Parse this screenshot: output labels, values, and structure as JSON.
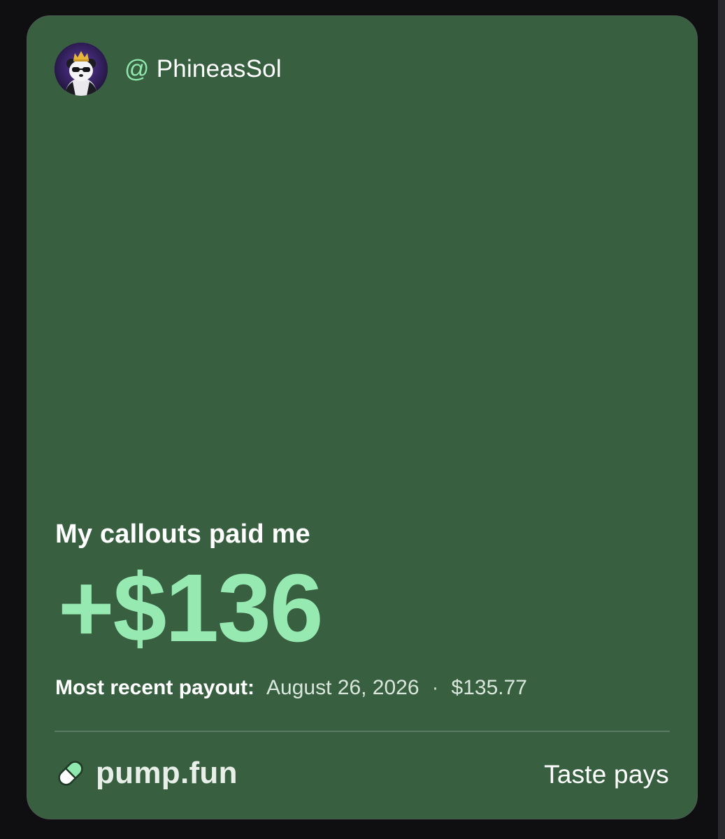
{
  "user": {
    "handle_prefix": "@",
    "handle": "PhineasSol",
    "avatar_icon": "panda-with-crown-avatar"
  },
  "headline": "My callouts paid me",
  "total_amount": "+$136",
  "payout": {
    "label": "Most recent payout:",
    "date": "August 26, 2026",
    "separator": "·",
    "amount": "$135.77"
  },
  "footer": {
    "brand_icon": "pill-icon",
    "brand": "pump.fun",
    "tagline": "Taste pays"
  },
  "colors": {
    "card_background": "#386040",
    "accent_green": "#95e9b1",
    "page_background": "#0f0f12"
  }
}
